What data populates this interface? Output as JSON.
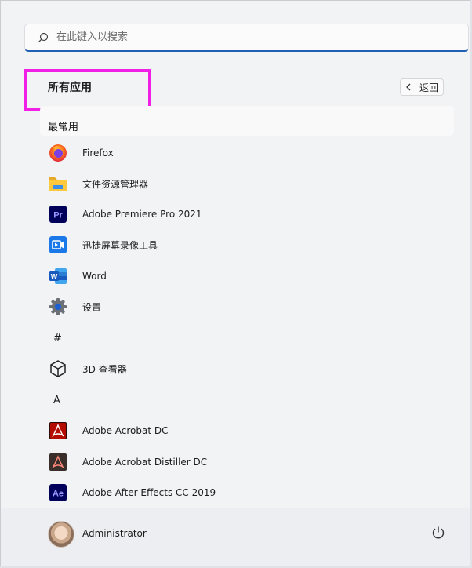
{
  "search": {
    "placeholder": "在此键入以搜索"
  },
  "section": {
    "title": "所有应用"
  },
  "back": {
    "label": "返回"
  },
  "group": {
    "label": "最常用"
  },
  "apps_top": [
    {
      "label": "Firefox",
      "icon": "firefox-icon"
    },
    {
      "label": "文件资源管理器",
      "icon": "folder-icon"
    },
    {
      "label": "Adobe Premiere Pro 2021",
      "icon": "premiere-pro-icon"
    },
    {
      "label": "迅捷屏幕录像工具",
      "icon": "screen-recorder-icon"
    },
    {
      "label": "Word",
      "icon": "word-icon"
    },
    {
      "label": "设置",
      "icon": "settings-gear-icon"
    }
  ],
  "letters": {
    "hash": "#",
    "a": "A"
  },
  "apps_hash": [
    {
      "label": "3D 查看器",
      "icon": "3d-viewer-icon"
    }
  ],
  "apps_a": [
    {
      "label": "Adobe Acrobat DC",
      "icon": "acrobat-icon"
    },
    {
      "label": "Adobe Acrobat Distiller DC",
      "icon": "acrobat-distiller-icon"
    },
    {
      "label": "Adobe After Effects CC 2019",
      "icon": "after-effects-icon"
    }
  ],
  "user": {
    "name": "Administrator"
  },
  "colors": {
    "accent": "#1f5fb4",
    "highlight": "#f020e6"
  }
}
